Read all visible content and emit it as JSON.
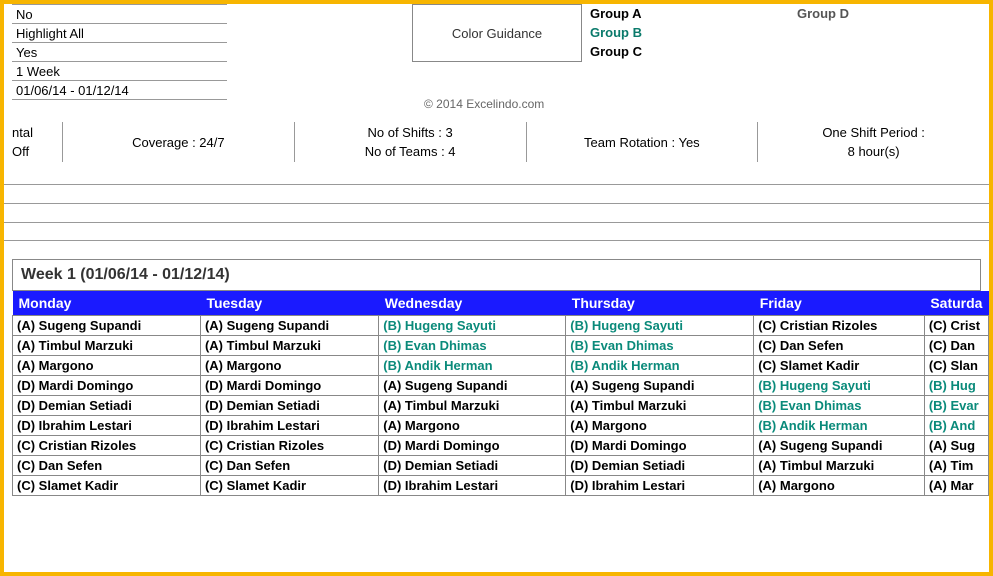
{
  "settings": {
    "items": [
      "No",
      "Highlight All",
      "Yes",
      "1 Week",
      "01/06/14 - 01/12/14"
    ]
  },
  "colorGuidance": "Color Guidance",
  "groupsLeft": [
    "Group A",
    "Group B",
    "Group C"
  ],
  "groupsRight": [
    "Group D"
  ],
  "copyright": "© 2014   Excelindo.com",
  "summaryLeft": [
    "ntal",
    "Off"
  ],
  "summary": {
    "coverage": "Coverage : 24/7",
    "shifts": "No of Shifts : 3",
    "teams": "No of Teams : 4",
    "rotation": "Team Rotation : Yes",
    "period1": "One Shift Period :",
    "period2": "8 hour(s)"
  },
  "weekTitle": "Week 1 (01/06/14 - 01/12/14)",
  "days": [
    "Monday",
    "Tuesday",
    "Wednesday",
    "Thursday",
    "Friday",
    "Saturda"
  ],
  "rows": [
    [
      {
        "t": "(A) Sugeng Supandi"
      },
      {
        "t": "(A) Sugeng Supandi"
      },
      {
        "t": "(B) Hugeng Sayuti",
        "c": "teal-text"
      },
      {
        "t": "(B) Hugeng Sayuti",
        "c": "teal-text"
      },
      {
        "t": "(C) Cristian Rizoles"
      },
      {
        "t": "(C) Crist"
      }
    ],
    [
      {
        "t": "(A) Timbul Marzuki"
      },
      {
        "t": "(A) Timbul Marzuki"
      },
      {
        "t": "(B) Evan Dhimas",
        "c": "teal-text"
      },
      {
        "t": "(B) Evan Dhimas",
        "c": "teal-text"
      },
      {
        "t": "(C) Dan Sefen"
      },
      {
        "t": "(C) Dan"
      }
    ],
    [
      {
        "t": "(A) Margono"
      },
      {
        "t": "(A) Margono"
      },
      {
        "t": "(B) Andik Herman",
        "c": "teal-text"
      },
      {
        "t": "(B) Andik Herman",
        "c": "teal-text"
      },
      {
        "t": "(C) Slamet Kadir"
      },
      {
        "t": "(C) Slan"
      }
    ],
    [
      {
        "t": "(D) Mardi Domingo"
      },
      {
        "t": "(D) Mardi Domingo"
      },
      {
        "t": "(A) Sugeng Supandi"
      },
      {
        "t": "(A) Sugeng Supandi"
      },
      {
        "t": "(B) Hugeng Sayuti",
        "c": "teal-text"
      },
      {
        "t": "(B) Hug",
        "c": "teal-text"
      }
    ],
    [
      {
        "t": "(D) Demian Setiadi"
      },
      {
        "t": "(D) Demian Setiadi"
      },
      {
        "t": "(A) Timbul Marzuki"
      },
      {
        "t": "(A) Timbul Marzuki"
      },
      {
        "t": "(B) Evan Dhimas",
        "c": "teal-text"
      },
      {
        "t": "(B) Evar",
        "c": "teal-text"
      }
    ],
    [
      {
        "t": "(D) Ibrahim Lestari"
      },
      {
        "t": "(D) Ibrahim Lestari"
      },
      {
        "t": "(A) Margono"
      },
      {
        "t": "(A) Margono"
      },
      {
        "t": "(B) Andik Herman",
        "c": "teal-text"
      },
      {
        "t": "(B) And",
        "c": "teal-text"
      }
    ],
    [
      {
        "t": "(C) Cristian Rizoles"
      },
      {
        "t": "(C) Cristian Rizoles"
      },
      {
        "t": "(D) Mardi Domingo"
      },
      {
        "t": "(D) Mardi Domingo"
      },
      {
        "t": "(A) Sugeng Supandi"
      },
      {
        "t": "(A) Sug"
      }
    ],
    [
      {
        "t": "(C) Dan Sefen"
      },
      {
        "t": "(C) Dan Sefen"
      },
      {
        "t": "(D) Demian Setiadi"
      },
      {
        "t": "(D) Demian Setiadi"
      },
      {
        "t": "(A) Timbul Marzuki"
      },
      {
        "t": "(A) Tim"
      }
    ],
    [
      {
        "t": "(C) Slamet Kadir"
      },
      {
        "t": "(C) Slamet Kadir"
      },
      {
        "t": "(D) Ibrahim Lestari"
      },
      {
        "t": "(D) Ibrahim Lestari"
      },
      {
        "t": "(A) Margono"
      },
      {
        "t": "(A) Mar"
      }
    ]
  ]
}
